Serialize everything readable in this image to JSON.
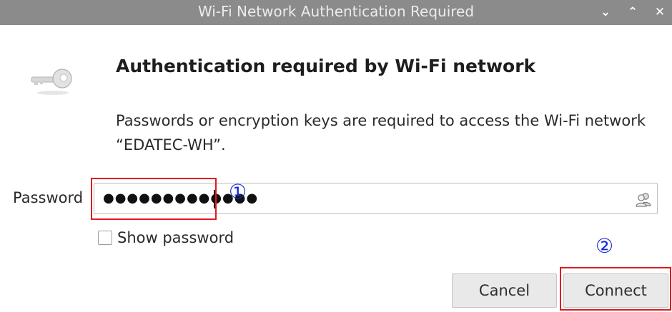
{
  "window": {
    "title": "Wi-Fi Network Authentication Required",
    "buttons": {
      "minimize": "⌄",
      "maximize": "⌃",
      "close": "✕"
    }
  },
  "dialog": {
    "icon": "key-icon",
    "heading": "Authentication required by Wi-Fi network",
    "message": "Passwords or encryption keys are required to access the Wi-Fi network “EDATEC-WH”.",
    "password": {
      "label": "Password",
      "masked_value": "●●●●●●●●●●●●●",
      "user_icon": "users-icon"
    },
    "show_password": {
      "label": "Show password",
      "checked": false
    },
    "buttons": {
      "cancel": "Cancel",
      "connect": "Connect"
    }
  },
  "annotations": {
    "step_one": "①",
    "step_two": "②",
    "highlight_color": "#e0191e",
    "marker_color": "#1a2bd6"
  }
}
